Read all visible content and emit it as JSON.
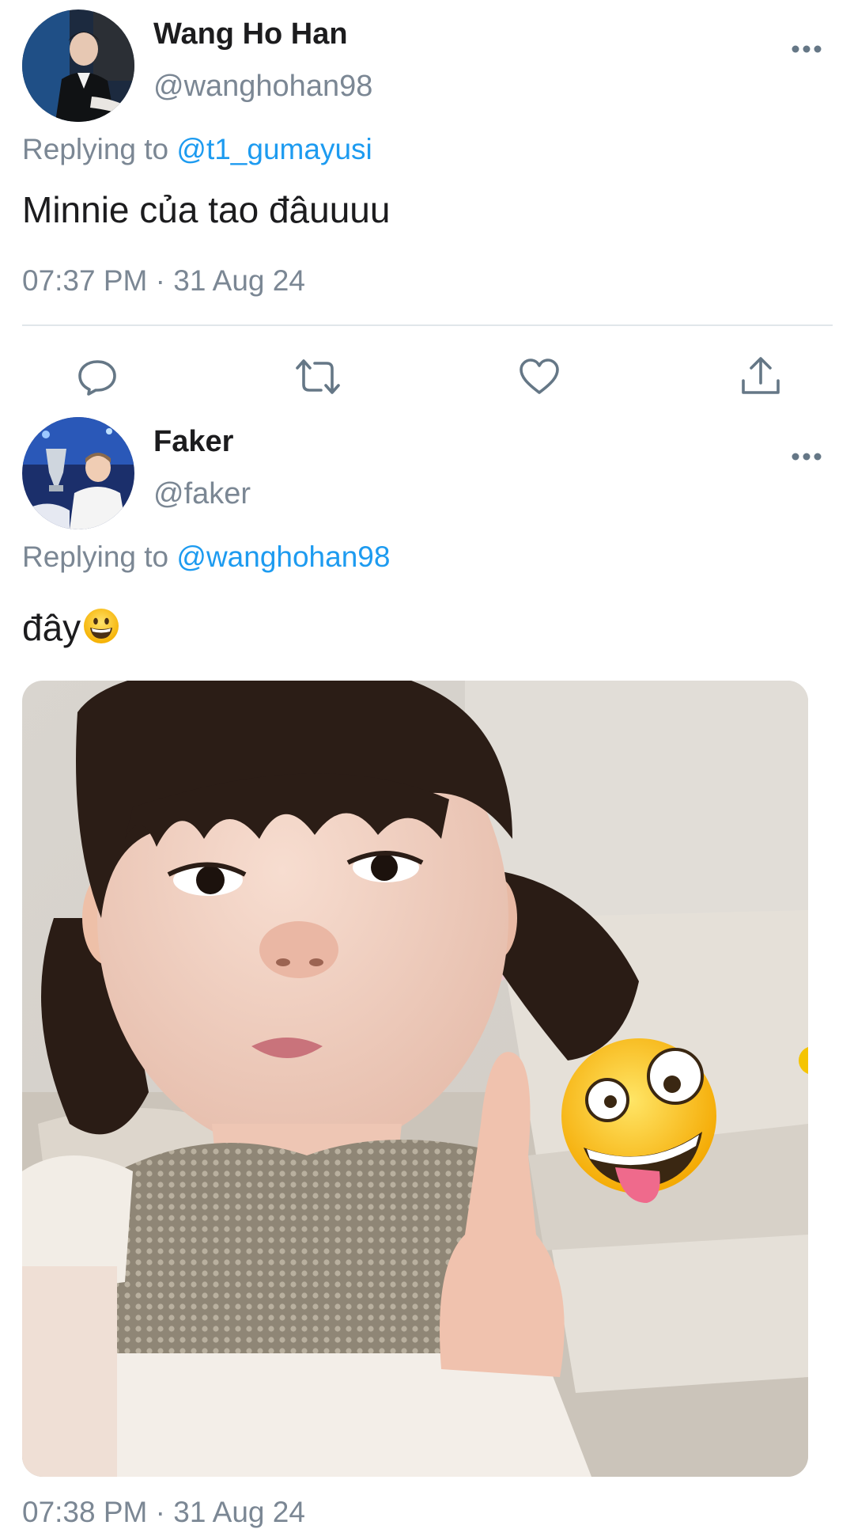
{
  "tweets": [
    {
      "display_name": "Wang Ho Han",
      "handle": "@wanghohan98",
      "replying_prefix": "Replying to",
      "replying_to": "@t1_gumayusi",
      "text": "Minnie của tao đâuuuu",
      "timestamp": "07:37 PM · 31 Aug 24"
    },
    {
      "display_name": "Faker",
      "handle": "@faker",
      "replying_prefix": "Replying to",
      "replying_to": "@wanghohan98",
      "text": "đây",
      "text_emoji": "grinning-face-emoji",
      "media": "photo-of-child-with-pigtails-and-zany-face-emoji",
      "timestamp": "07:38 PM · 31 Aug 24"
    }
  ],
  "actions": [
    "reply-icon",
    "retweet-icon",
    "like-icon",
    "share-icon"
  ],
  "colors": {
    "link": "#1d9bf0",
    "secondary_text": "#7b8794",
    "divider": "#e1e6ea",
    "icon": "#657786"
  }
}
